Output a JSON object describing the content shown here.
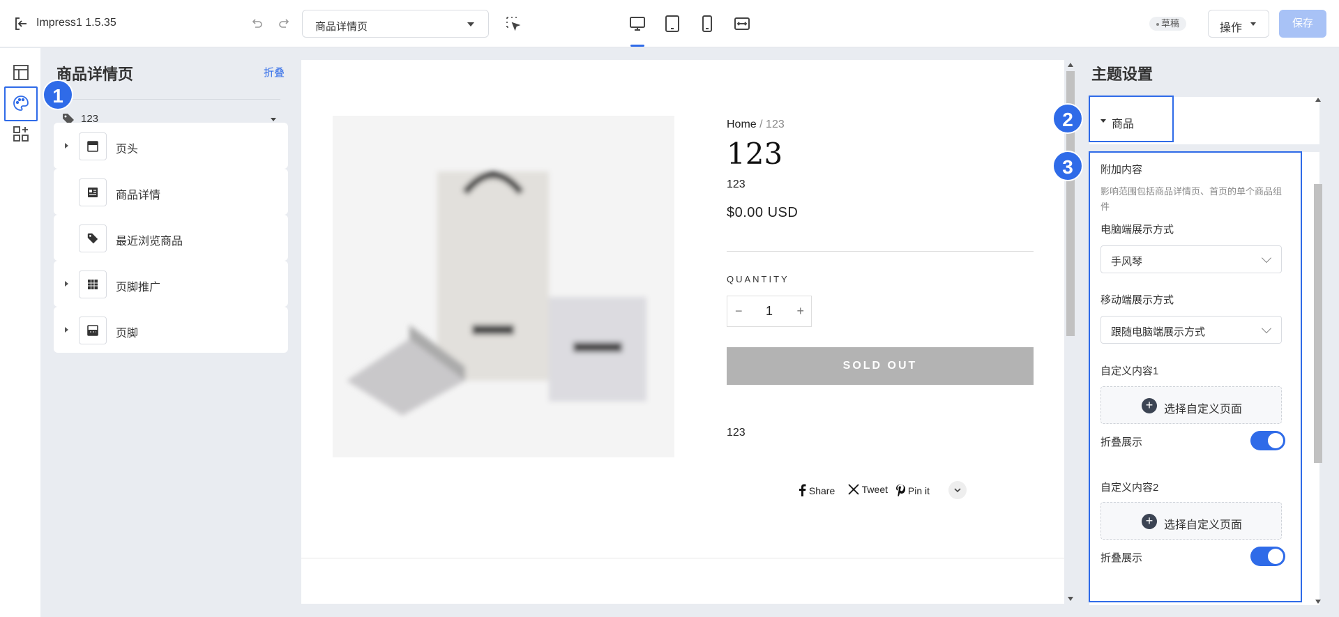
{
  "app": {
    "title": "Impress1 1.5.35"
  },
  "toolbar": {
    "page_select": "商品详情页",
    "draft_badge": "草稿",
    "ops_label": "操作",
    "save_label": "保存"
  },
  "sidebar": {
    "title": "商品详情页",
    "collapse": "折叠",
    "tag_value": "123",
    "sections": [
      {
        "label": "页头",
        "icon": "header-icon",
        "expandable": true
      },
      {
        "label": "商品详情",
        "icon": "product-detail-icon",
        "expandable": false
      },
      {
        "label": "最近浏览商品",
        "icon": "tag-icon",
        "expandable": false
      },
      {
        "label": "页脚推广",
        "icon": "grid-icon",
        "expandable": true
      },
      {
        "label": "页脚",
        "icon": "footer-icon",
        "expandable": true
      }
    ]
  },
  "steps": [
    "1",
    "2",
    "3"
  ],
  "canvas": {
    "breadcrumb_home": "Home",
    "breadcrumb_sep": "/",
    "breadcrumb_current": "123",
    "product_title": "123",
    "product_sub": "123",
    "price": "$0.00 USD",
    "quantity_label": "QUANTITY",
    "quantity_value": "1",
    "qty_minus": "−",
    "qty_plus": "+",
    "soldout": "SOLD OUT",
    "description": "123",
    "share": {
      "facebook": "Share",
      "x": "Tweet",
      "pinterest": "Pin it"
    }
  },
  "settings": {
    "title": "主题设置",
    "group_label": "商品",
    "addon_title": "附加内容",
    "addon_hint": "影响范围包括商品详情页、首页的单个商品组件",
    "desktop_label": "电脑端展示方式",
    "desktop_value": "手风琴",
    "mobile_label": "移动端展示方式",
    "mobile_value": "跟随电脑端展示方式",
    "custom1_label": "自定义内容1",
    "custom1_add": "选择自定义页面",
    "fold1_label": "折叠展示",
    "custom2_label": "自定义内容2",
    "custom2_add": "选择自定义页面",
    "fold2_label": "折叠展示"
  },
  "colors": {
    "accent": "#2f6be8",
    "save_disabled": "#a8c2f6",
    "soldout": "#b3b3b3"
  }
}
